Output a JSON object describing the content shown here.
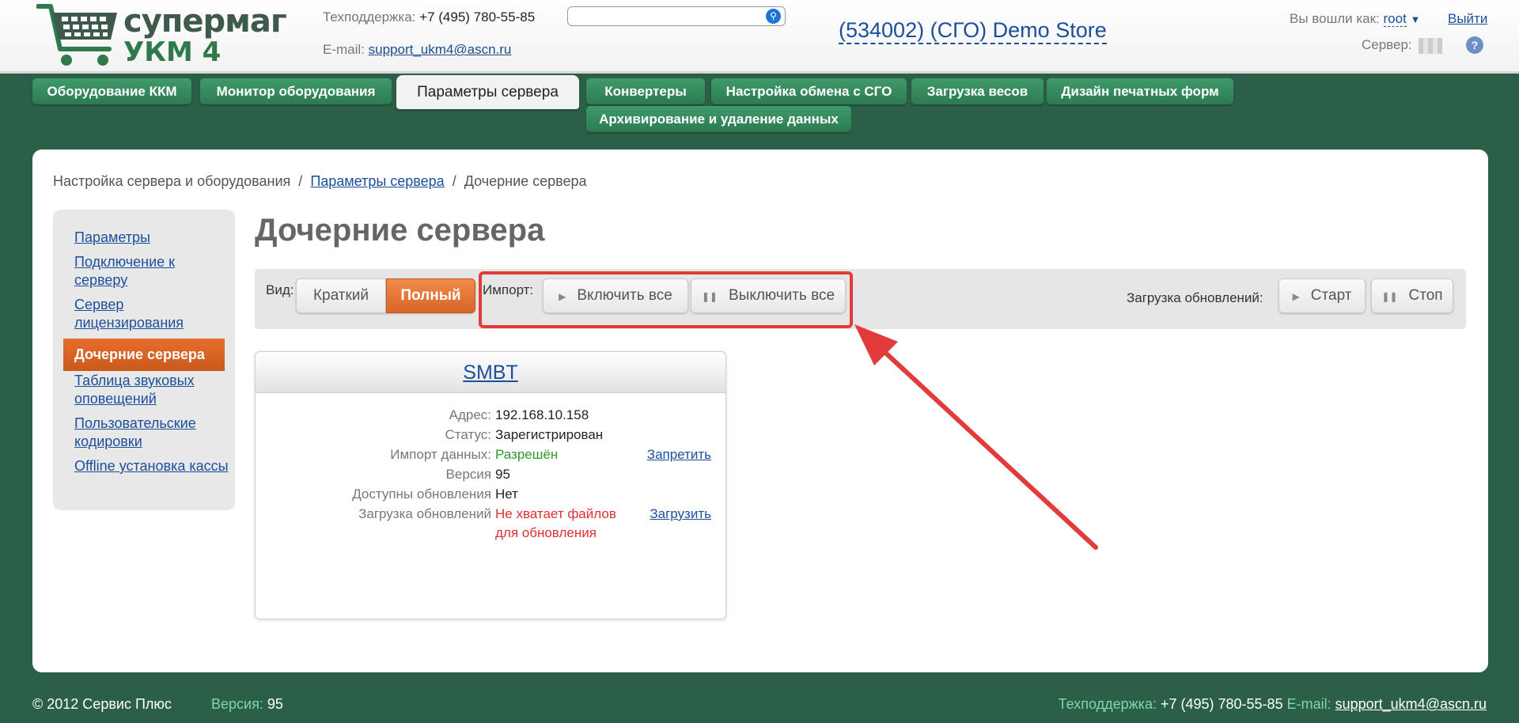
{
  "header": {
    "logo_line1": "супермаг",
    "logo_line2": "УКМ 4",
    "support_label": "Техподдержка:",
    "support_phone": "+7 (495) 780-55-85",
    "email_label": "E-mail:",
    "email": "support_ukm4@ascn.ru",
    "search_placeholder": "",
    "store": "(534002) (СГО) Demo Store",
    "logged_in_label": "Вы вошли как:",
    "user": "root",
    "logout": "Выйти",
    "server_label": "Сервер:"
  },
  "nav": [
    "Оборудование ККМ",
    "Монитор оборудования",
    "Параметры сервера",
    "Конвертеры",
    "Настройка обмена с СГО",
    "Загрузка весов",
    "Дизайн печатных форм",
    "Архивирование и удаление данных"
  ],
  "breadcrumb": {
    "item1": "Настройка сервера и оборудования",
    "sep": "/",
    "item2": "Параметры сервера",
    "item3": "Дочерние сервера"
  },
  "sidebar": [
    "Параметры",
    "Подключение к серверу",
    "Сервер лицензирования",
    "Дочерние сервера",
    "Таблица звуковых оповещений",
    "Пользовательские кодировки",
    "Offline установка кассы"
  ],
  "page_title": "Дочерние сервера",
  "toolbar": {
    "view_label": "Вид:",
    "view_short": "Краткий",
    "view_full": "Полный",
    "import_label": "Импорт:",
    "enable_all": "Включить все",
    "disable_all": "Выключить все",
    "updates_label": "Загрузка обновлений:",
    "start": "Старт",
    "stop": "Стоп"
  },
  "card": {
    "title": "SMBT",
    "address_label": "Адрес:",
    "address": "192.168.10.158",
    "status_label": "Статус:",
    "status": "Зарегистрирован",
    "import_label": "Импорт данных:",
    "import_value": "Разрешён",
    "import_action": "Запретить",
    "version_label": "Версия",
    "version": "95",
    "updates_available_label": "Доступны обновления",
    "updates_available": "Нет",
    "updates_load_label": "Загрузка обновлений",
    "updates_load_value": "Не хватает файлов для обновления",
    "updates_load_action": "Загрузить"
  },
  "footer": {
    "copyright": "© 2012 Сервис Плюс",
    "version_label": "Версия:",
    "version": "95",
    "support_label": "Техподдержка:",
    "support_phone": "+7 (495) 780-55-85",
    "email_label": "E-mail:",
    "email": "support_ukm4@ascn.ru"
  },
  "colors": {
    "background": "#2c5f48",
    "nav_green": "#2d7a52",
    "accent_orange": "#d9642a",
    "link_blue": "#1b4f9c",
    "highlight_red": "#e23b3b"
  }
}
